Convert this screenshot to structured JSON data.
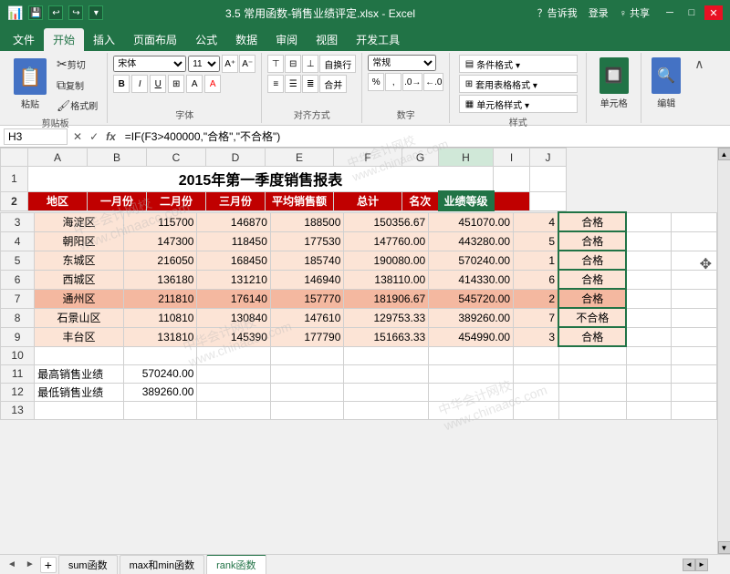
{
  "titleBar": {
    "title": "3.5 常用函数-销售业绩评定.xlsx - Excel",
    "icon": "📊"
  },
  "ribbonTabs": [
    {
      "label": "文件",
      "active": false
    },
    {
      "label": "开始",
      "active": true
    },
    {
      "label": "插入",
      "active": false
    },
    {
      "label": "页面布局",
      "active": false
    },
    {
      "label": "公式",
      "active": false
    },
    {
      "label": "数据",
      "active": false
    },
    {
      "label": "审阅",
      "active": false
    },
    {
      "label": "视图",
      "active": false
    },
    {
      "label": "开发工具",
      "active": false
    }
  ],
  "ribbonGroups": [
    {
      "name": "剪贴板",
      "buttons": [
        "粘贴",
        "剪切",
        "复制",
        "格式刷"
      ]
    },
    {
      "name": "字体",
      "buttons": [
        "字体"
      ]
    },
    {
      "name": "对齐方式",
      "buttons": [
        "对齐方式"
      ]
    },
    {
      "name": "数字",
      "buttons": [
        "数字"
      ]
    },
    {
      "name": "样式",
      "buttons": [
        "条件格式",
        "套用表格格式",
        "单元格样式"
      ]
    },
    {
      "name": "单元格",
      "buttons": [
        "单元格"
      ]
    },
    {
      "name": "编辑",
      "buttons": [
        "编辑"
      ]
    }
  ],
  "formulaBar": {
    "nameBox": "H3",
    "formula": "=IF(F3>400000,\"合格\",\"不合格\")"
  },
  "spreadsheet": {
    "title": "2015年第一季度销售报表",
    "headers": [
      "地区",
      "一月份",
      "二月份",
      "三月份",
      "平均销售额",
      "总计",
      "名次",
      "业绩等级"
    ],
    "rows": [
      {
        "region": "海淀区",
        "jan": "115700",
        "feb": "146870",
        "mar": "188500",
        "avg": "150356.67",
        "total": "451070.00",
        "rank": "4",
        "grade": "合格"
      },
      {
        "region": "朝阳区",
        "jan": "147300",
        "feb": "118450",
        "mar": "177530",
        "avg": "147760.00",
        "total": "443280.00",
        "rank": "5",
        "grade": "合格"
      },
      {
        "region": "东城区",
        "jan": "216050",
        "feb": "168450",
        "mar": "185740",
        "avg": "190080.00",
        "total": "570240.00",
        "rank": "1",
        "grade": "合格"
      },
      {
        "region": "西城区",
        "jan": "136180",
        "feb": "131210",
        "mar": "146940",
        "avg": "138110.00",
        "total": "414330.00",
        "rank": "6",
        "grade": "合格"
      },
      {
        "region": "通州区",
        "jan": "211810",
        "feb": "176140",
        "mar": "157770",
        "avg": "181906.67",
        "total": "545720.00",
        "rank": "2",
        "grade": "合格"
      },
      {
        "region": "石景山区",
        "jan": "110810",
        "feb": "130840",
        "mar": "147610",
        "avg": "129753.33",
        "total": "389260.00",
        "rank": "7",
        "grade": "不合格"
      },
      {
        "region": "丰台区",
        "jan": "131810",
        "feb": "145390",
        "mar": "177790",
        "avg": "151663.33",
        "total": "454990.00",
        "rank": "3",
        "grade": "合格"
      }
    ],
    "stats": {
      "maxLabel": "最高销售业绩",
      "maxValue": "570240.00",
      "minLabel": "最低销售业绩",
      "minValue": "389260.00"
    }
  },
  "sheetTabs": [
    {
      "label": "sum函数",
      "active": false
    },
    {
      "label": "max和min函数",
      "active": false
    },
    {
      "label": "rank函数",
      "active": true
    }
  ],
  "windowControls": {
    "minimize": "─",
    "maximize": "□",
    "close": "✕"
  },
  "topRightActions": {
    "help": "？告诉我",
    "login": "登录",
    "share": "♀ 共享"
  }
}
